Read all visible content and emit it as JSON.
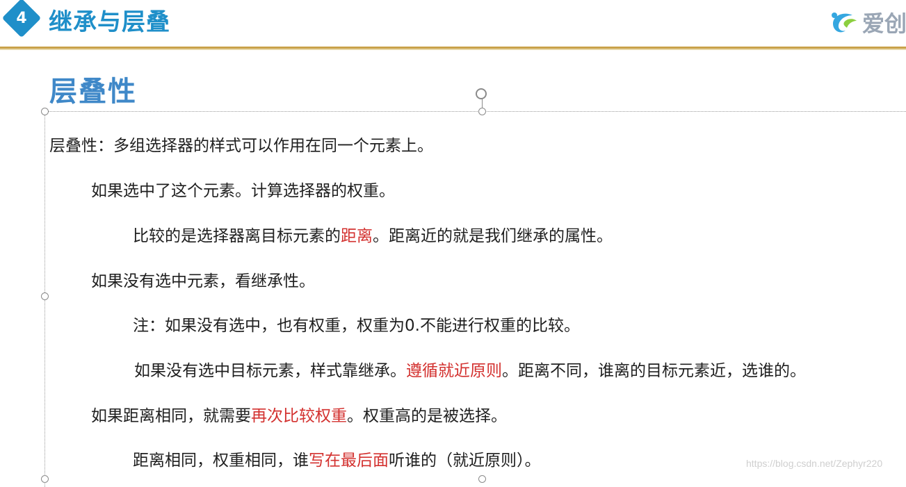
{
  "header": {
    "section_number": "4",
    "title": "继承与层叠",
    "logo_text": "爱创"
  },
  "slide": {
    "title": "层叠性",
    "lines": [
      {
        "parts": [
          "层叠性：多组选择器的样式可以作用在同一个元素上。"
        ]
      },
      {
        "parts": [
          "如果选中了这个元素。计算选择器的权重。"
        ]
      },
      {
        "parts": [
          "比较的是选择器离目标元素的",
          "距离",
          "。距离近的就是我们继承的属性。"
        ]
      },
      {
        "parts": [
          "如果没有选中元素，看继承性。"
        ]
      },
      {
        "parts": [
          "注：如果没有选中，也有权重，权重为0.不能进行权重的比较。"
        ]
      },
      {
        "parts": [
          "如果没有选中目标元素，样式靠继承。",
          "遵循就近原则",
          "。距离不同，谁离的目标元素近，选谁的。"
        ]
      },
      {
        "parts": [
          "如果距离相同，就需要",
          "再次比较权重",
          "。权重高的是被选择。"
        ]
      },
      {
        "parts": [
          "距离相同，权重相同，谁",
          "写在最后面",
          "听谁的（就近原则）。"
        ]
      }
    ]
  },
  "watermark": "https://blog.csdn.net/Zephyr220",
  "colors": {
    "accent_blue": "#1f8fc9",
    "title_blue": "#3f88c8",
    "highlight_red": "#d3312f",
    "rule_gold": "#c9a24a"
  },
  "icons": {
    "section_badge": "diamond-badge-icon",
    "logo": "aichuang-logo-icon",
    "rotate": "rotate-handle-icon"
  }
}
